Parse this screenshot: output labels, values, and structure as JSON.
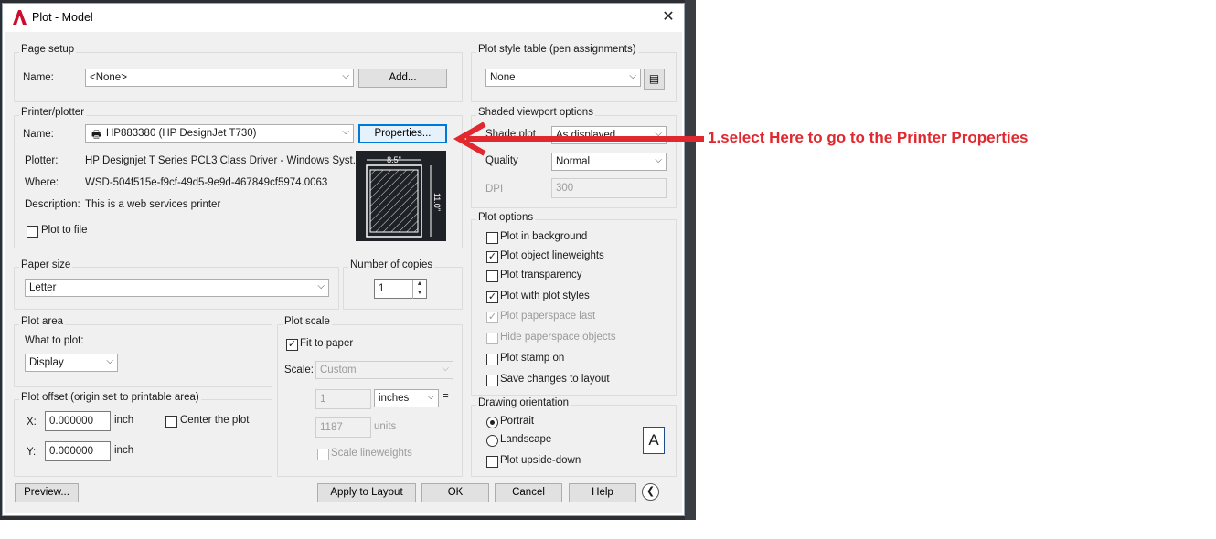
{
  "window": {
    "title": "Plot - Model",
    "close_icon": "close-icon"
  },
  "page_setup": {
    "group": "Page setup",
    "name_label": "Name:",
    "name_value": "<None>",
    "add_button": "Add..."
  },
  "printer": {
    "group": "Printer/plotter",
    "name_label": "Name:",
    "name_value": "HP883380 (HP DesignJet T730)",
    "properties_button": "Properties...",
    "plotter_label": "Plotter:",
    "plotter_value": "HP Designjet T Series PCL3 Class Driver - Windows Syst...",
    "where_label": "Where:",
    "where_value": "WSD-504f515e-f9cf-49d5-9e9d-467849cf5974.0063",
    "description_label": "Description:",
    "description_value": "This is a web services printer",
    "plot_to_file": "Plot to file",
    "preview_width": "8.5\"",
    "preview_height": "11.0\""
  },
  "paper_size": {
    "group": "Paper size",
    "value": "Letter"
  },
  "copies": {
    "group": "Number of copies",
    "value": "1"
  },
  "plot_area": {
    "group": "Plot area",
    "what_label": "What to plot:",
    "value": "Display"
  },
  "plot_offset": {
    "group": "Plot offset (origin set to printable area)",
    "x_label": "X:",
    "x_value": "0.000000",
    "x_unit": "inch",
    "y_label": "Y:",
    "y_value": "0.000000",
    "y_unit": "inch",
    "center": "Center the plot"
  },
  "plot_scale": {
    "group": "Plot scale",
    "fit": "Fit to paper",
    "scale_label": "Scale:",
    "scale_value": "Custom",
    "val1": "1",
    "unit_value": "inches",
    "equals": "=",
    "val2": "1187",
    "units_label": "units",
    "lineweights": "Scale lineweights"
  },
  "plot_style": {
    "group": "Plot style table (pen assignments)",
    "value": "None"
  },
  "shaded": {
    "group": "Shaded viewport options",
    "shade_label": "Shade plot",
    "shade_value": "As displayed",
    "quality_label": "Quality",
    "quality_value": "Normal",
    "dpi_label": "DPI",
    "dpi_value": "300"
  },
  "plot_options": {
    "group": "Plot options",
    "items": [
      {
        "label": "Plot in background",
        "checked": false,
        "disabled": false
      },
      {
        "label": "Plot object lineweights",
        "checked": true,
        "disabled": false
      },
      {
        "label": "Plot transparency",
        "checked": false,
        "disabled": false
      },
      {
        "label": "Plot with plot styles",
        "checked": true,
        "disabled": false
      },
      {
        "label": "Plot paperspace last",
        "checked": true,
        "disabled": true
      },
      {
        "label": "Hide paperspace objects",
        "checked": false,
        "disabled": true
      },
      {
        "label": "Plot stamp on",
        "checked": false,
        "disabled": false
      },
      {
        "label": "Save changes to layout",
        "checked": false,
        "disabled": false
      }
    ]
  },
  "orientation": {
    "group": "Drawing orientation",
    "portrait": "Portrait",
    "landscape": "Landscape",
    "upside_down": "Plot upside-down",
    "icon_letter": "A"
  },
  "footer": {
    "preview": "Preview...",
    "apply": "Apply to Layout",
    "ok": "OK",
    "cancel": "Cancel",
    "help": "Help"
  },
  "annotation": {
    "text": "1.select Here to go to the Printer Properties",
    "color": "#e0282e"
  }
}
